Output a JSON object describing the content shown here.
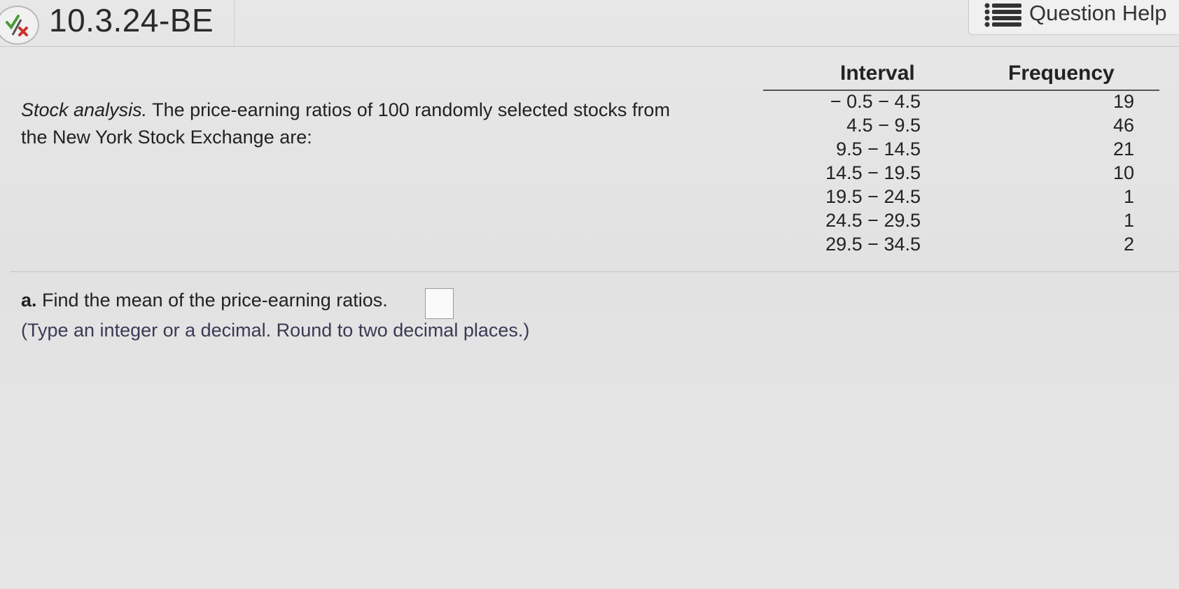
{
  "header": {
    "question_id": "10.3.24-BE",
    "status_icon": "partially-correct-icon",
    "help_label": "Question Help",
    "help_icon": "list-icon"
  },
  "problem": {
    "lead_italic": "Stock analysis.",
    "line1_rest": " The price-earning ratios of 100 randomly selected stocks from",
    "line2": "the New York Stock Exchange are:"
  },
  "table": {
    "headers": [
      "Interval",
      "Frequency"
    ],
    "rows": [
      {
        "interval": "− 0.5 − 4.5",
        "frequency": "19"
      },
      {
        "interval": "4.5 − 9.5",
        "frequency": "46"
      },
      {
        "interval": "9.5 − 14.5",
        "frequency": "21"
      },
      {
        "interval": "14.5 − 19.5",
        "frequency": "10"
      },
      {
        "interval": "19.5 − 24.5",
        "frequency": "1"
      },
      {
        "interval": "24.5 − 29.5",
        "frequency": "1"
      },
      {
        "interval": "29.5 − 34.5",
        "frequency": "2"
      }
    ]
  },
  "part_a": {
    "label": "a.",
    "question": " Find the mean of the price-earning ratios.",
    "answer_value": "",
    "hint": "(Type an integer or a decimal. Round to two decimal places.)"
  }
}
